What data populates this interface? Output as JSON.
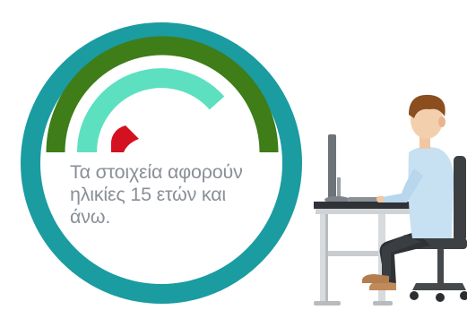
{
  "colors": {
    "ring": "#1A9CA1",
    "outer_arc": "#3E7D18",
    "inner_arc": "#5CE0C0",
    "needle": "#D31121",
    "caption": "#8A8F96"
  },
  "gauge": {
    "icon": "speedometer-gauge-icon",
    "level_fraction": 0.15
  },
  "caption": {
    "lines": [
      "Τα στοιχεία αφορούν",
      "ηλικίες 15 ετών και",
      "άνω."
    ]
  },
  "illustration": {
    "icon": "person-at-computer-desk-icon"
  }
}
